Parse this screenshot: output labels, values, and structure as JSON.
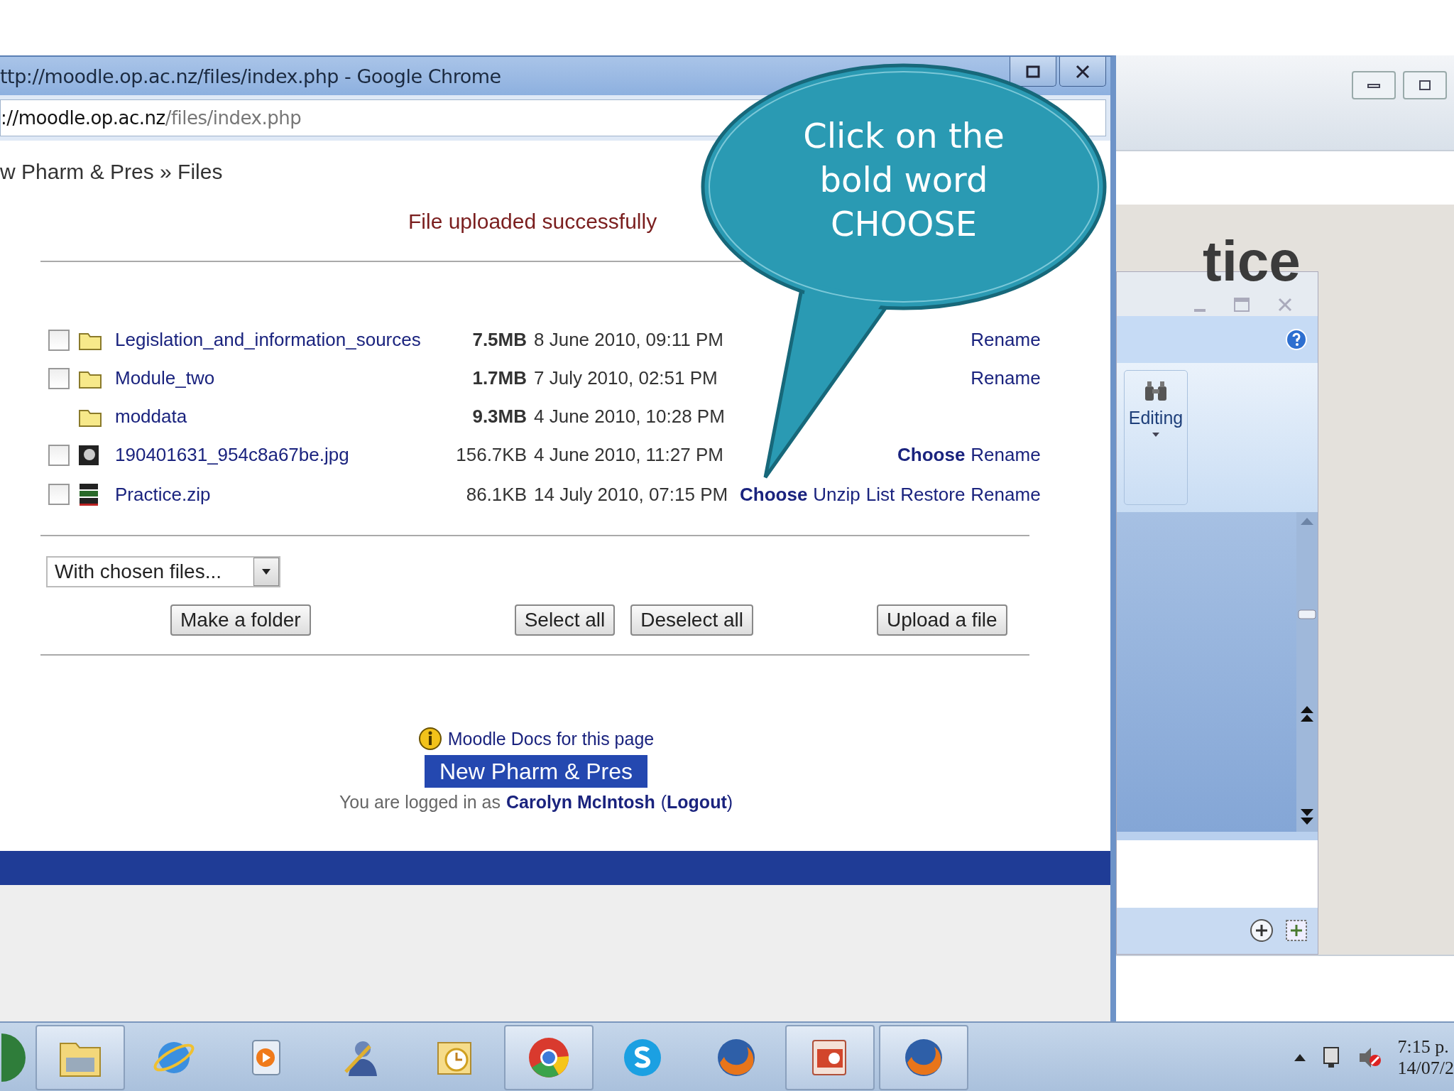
{
  "browser": {
    "title": "ttp://moodle.op.ac.nz/files/index.php - Google Chrome",
    "address_host": "://moodle.op.ac.nz",
    "address_path": "/files/index.php",
    "breadcrumb": "w Pharm & Pres » Files",
    "notice": "File uploaded successfully",
    "files": [
      {
        "kind": "folder",
        "checked": false,
        "name": "Legislation_and_information_sources",
        "size": "7.5MB",
        "date": "8 June 2010, 09:11 PM",
        "actions": [
          {
            "label": "Rename",
            "kind": "plain"
          }
        ]
      },
      {
        "kind": "folder",
        "checked": false,
        "name": "Module_two",
        "size": "1.7MB",
        "date": "7 July 2010, 02:51 PM",
        "actions": [
          {
            "label": "Rename",
            "kind": "plain"
          }
        ]
      },
      {
        "kind": "folder",
        "name": "moddata",
        "size": "9.3MB",
        "date": "4 June 2010, 10:28 PM"
      },
      {
        "kind": "image",
        "checked": false,
        "name": "190401631_954c8a67be.jpg",
        "size": "156.7KB",
        "date": "4 June 2010, 11:27 PM",
        "actions": [
          {
            "label": "Choose",
            "kind": "primary"
          },
          {
            "label": "Rename",
            "kind": "plain"
          }
        ]
      },
      {
        "kind": "archive",
        "checked": false,
        "name": "Practice.zip",
        "size": "86.1KB",
        "date": "14 July 2010, 07:15 PM",
        "actions": [
          {
            "label": "Choose",
            "kind": "primary"
          },
          {
            "label": "Unzip",
            "kind": "plain"
          },
          {
            "label": "List",
            "kind": "plain"
          },
          {
            "label": "Restore",
            "kind": "plain"
          },
          {
            "label": "Rename",
            "kind": "plain"
          }
        ]
      }
    ],
    "bulk_select": "With chosen files...",
    "buttons": [
      "Make a folder",
      "Select all",
      "Deselect all",
      "Upload a file"
    ],
    "docs_link": "Moodle Docs for this page",
    "course_name": "New Pharm & Pres",
    "login": {
      "prefix": "You are logged in as",
      "user": "Carolyn McIntosh",
      "logout": "(**Logout**)"
    }
  },
  "presentation": {
    "slide_title": "tice",
    "ribbon_group": "Editing"
  },
  "callout": {
    "lines": [
      "Click on the",
      "bold word",
      "CHOOSE"
    ]
  },
  "taskbar": {
    "buttons": [
      {
        "running": false
      },
      {
        "running": true
      },
      {
        "running": false
      },
      {
        "running": false
      },
      {
        "running": false
      },
      {
        "running": false
      },
      {
        "running": true
      },
      {
        "running": false
      },
      {
        "running": false
      },
      {
        "running": true
      },
      {
        "running": true
      }
    ],
    "time": "7:15 p.",
    "date": "14/07/2"
  }
}
